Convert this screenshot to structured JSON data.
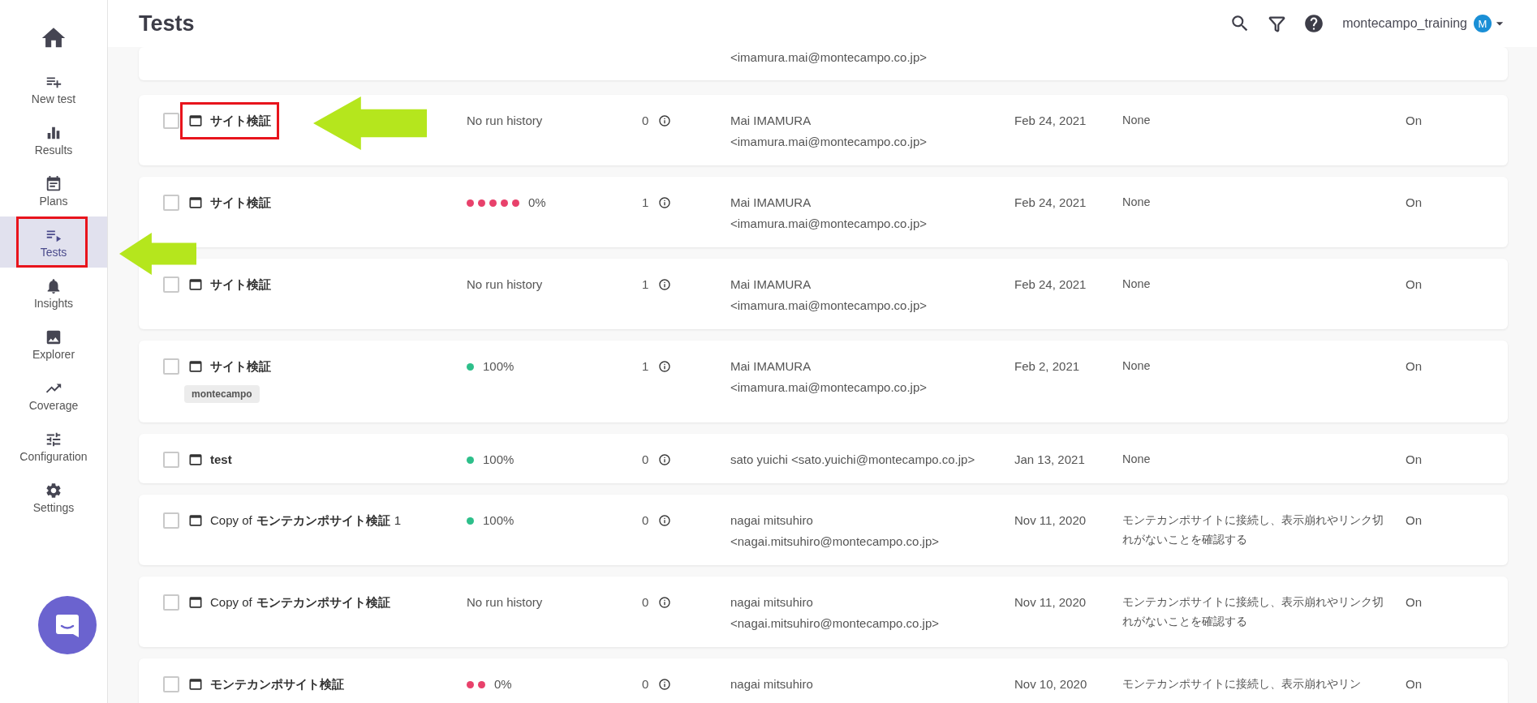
{
  "header": {
    "title": "Tests",
    "user": "montecampo_training",
    "avatar": "M"
  },
  "sidebar": {
    "items": [
      {
        "label": "New test",
        "selected": false,
        "highlighted": false
      },
      {
        "label": "Results",
        "selected": false,
        "highlighted": false
      },
      {
        "label": "Plans",
        "selected": false,
        "highlighted": false
      },
      {
        "label": "Tests",
        "selected": true,
        "highlighted": true
      },
      {
        "label": "Insights",
        "selected": false,
        "highlighted": false
      },
      {
        "label": "Explorer",
        "selected": false,
        "highlighted": false
      },
      {
        "label": "Coverage",
        "selected": false,
        "highlighted": false
      },
      {
        "label": "Configuration",
        "selected": false,
        "highlighted": false
      },
      {
        "label": "Settings",
        "selected": false,
        "highlighted": false
      }
    ]
  },
  "rows": [
    {
      "kind": "cut",
      "owner": [
        "<imamura.mai@montecampo.co.jp>"
      ]
    },
    {
      "kind": "full",
      "checked": false,
      "highlighted": true,
      "name": "サイト検証",
      "tags": [],
      "status": {
        "kind": "none",
        "text": "No run history"
      },
      "count": "0",
      "owner": [
        "Mai IMAMURA",
        "<imamura.mai@montecampo.co.jp>"
      ],
      "date": "Feb 24, 2021",
      "description": "None",
      "state": "On"
    },
    {
      "kind": "full",
      "checked": false,
      "highlighted": false,
      "name": "サイト検証",
      "tags": [],
      "status": {
        "kind": "runs",
        "dots": [
          {
            "color": "#e8416b"
          },
          {
            "color": "#e8416b"
          },
          {
            "color": "#e8416b"
          },
          {
            "color": "#e8416b"
          },
          {
            "color": "#e8416b"
          }
        ],
        "text": "0%"
      },
      "count": "1",
      "owner": [
        "Mai IMAMURA",
        "<imamura.mai@montecampo.co.jp>"
      ],
      "date": "Feb 24, 2021",
      "description": "None",
      "state": "On"
    },
    {
      "kind": "full",
      "checked": false,
      "highlighted": false,
      "name": "サイト検証",
      "tags": [],
      "status": {
        "kind": "none",
        "text": "No run history"
      },
      "count": "1",
      "owner": [
        "Mai IMAMURA",
        "<imamura.mai@montecampo.co.jp>"
      ],
      "date": "Feb 24, 2021",
      "description": "None",
      "state": "On"
    },
    {
      "kind": "full",
      "checked": false,
      "highlighted": false,
      "name": "サイト検証",
      "tags": [
        "montecampo"
      ],
      "status": {
        "kind": "runs",
        "dots": [
          {
            "color": "#2dbf8a"
          }
        ],
        "text": "100%"
      },
      "count": "1",
      "owner": [
        "Mai IMAMURA",
        "<imamura.mai@montecampo.co.jp>"
      ],
      "date": "Feb 2, 2021",
      "description": "None",
      "state": "On"
    },
    {
      "kind": "full",
      "checked": false,
      "highlighted": false,
      "name": "test",
      "tags": [],
      "status": {
        "kind": "runs",
        "dots": [
          {
            "color": "#2dbf8a"
          }
        ],
        "text": "100%"
      },
      "count": "0",
      "owner": [
        "sato yuichi <sato.yuichi@montecampo.co.jp>"
      ],
      "date": "Jan 13, 2021",
      "description": "None",
      "state": "On"
    },
    {
      "kind": "full",
      "checked": false,
      "highlighted": false,
      "prefix": "Copy of",
      "name": "モンテカンポサイト検証",
      "suffix": "1",
      "tags": [],
      "status": {
        "kind": "runs",
        "dots": [
          {
            "color": "#2dbf8a"
          }
        ],
        "text": "100%"
      },
      "count": "0",
      "owner": [
        "nagai mitsuhiro",
        "<nagai.mitsuhiro@montecampo.co.jp>"
      ],
      "date": "Nov 11, 2020",
      "description": "モンテカンポサイトに接続し、表示崩れやリンク切れがないことを確認する",
      "state": "On"
    },
    {
      "kind": "full",
      "checked": false,
      "highlighted": false,
      "prefix": "Copy of",
      "name": "モンテカンポサイト検証",
      "tags": [],
      "status": {
        "kind": "none",
        "text": "No run history"
      },
      "count": "0",
      "owner": [
        "nagai mitsuhiro",
        "<nagai.mitsuhiro@montecampo.co.jp>"
      ],
      "date": "Nov 11, 2020",
      "description": "モンテカンポサイトに接続し、表示崩れやリンク切れがないことを確認する",
      "state": "On"
    },
    {
      "kind": "full",
      "checked": false,
      "highlighted": false,
      "name": "モンテカンポサイト検証",
      "tags": [],
      "status": {
        "kind": "runs",
        "dots": [
          {
            "color": "#e8416b"
          },
          {
            "color": "#e8416b"
          }
        ],
        "text": "0%"
      },
      "count": "0",
      "owner": [
        "nagai mitsuhiro"
      ],
      "date": "Nov 10, 2020",
      "description": "モンテカンポサイトに接続し、表示崩れやリン",
      "state": "On"
    }
  ]
}
